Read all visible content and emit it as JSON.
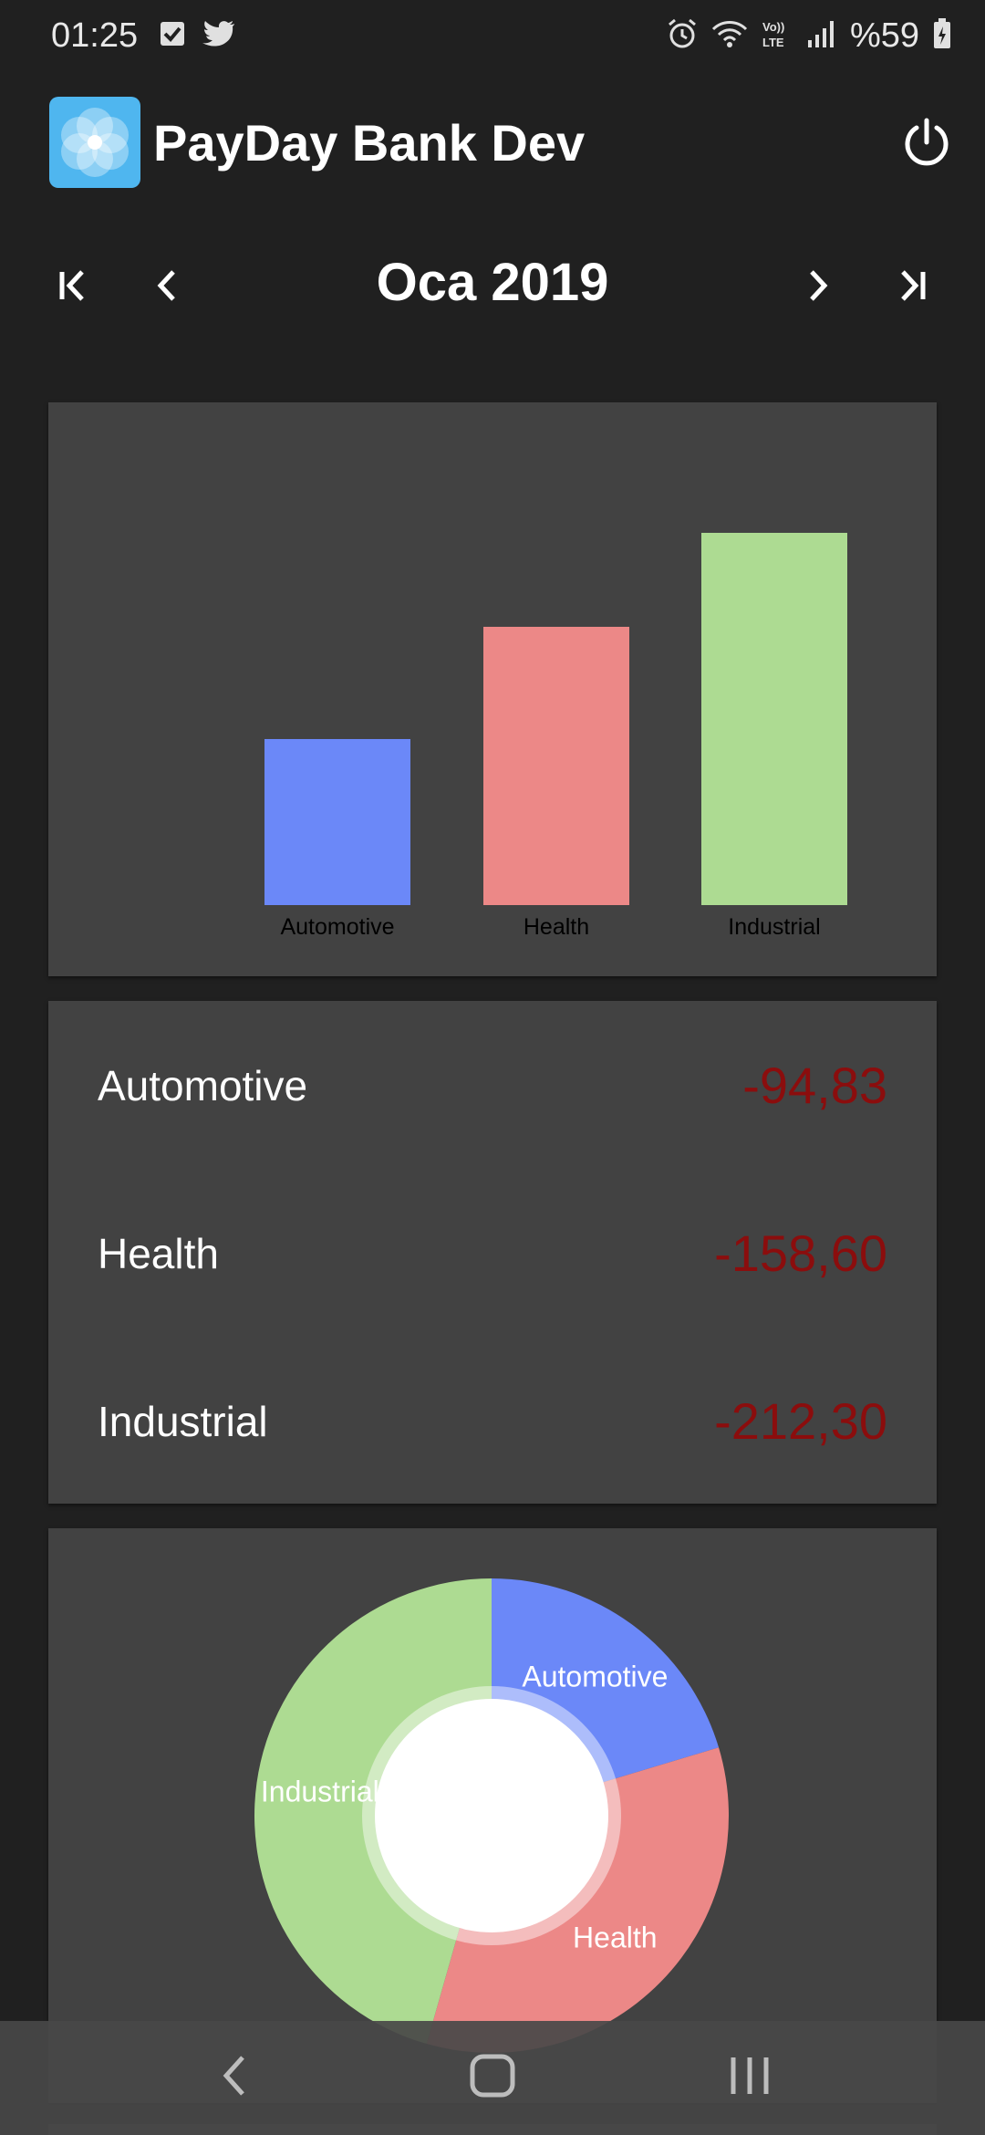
{
  "status_bar": {
    "time": "01:25",
    "battery": "%59",
    "icons": [
      "checkbox-notification-icon",
      "twitter-icon",
      "alarm-icon",
      "wifi-icon",
      "volte-icon",
      "signal-icon",
      "battery-icon"
    ]
  },
  "app_bar": {
    "title": "PayDay Bank Dev",
    "logo_icon": "flower-logo-icon",
    "power_icon": "power-icon"
  },
  "month_nav": {
    "label": "Oca 2019",
    "icons": [
      "first-page-icon",
      "chevron-left-icon",
      "chevron-right-icon",
      "last-page-icon"
    ]
  },
  "chart_data": [
    {
      "type": "bar",
      "categories": [
        "Automotive",
        "Health",
        "Industrial"
      ],
      "values": [
        94.83,
        158.6,
        212.3
      ],
      "colors": [
        "#6b88f8",
        "#ec8887",
        "#addb92"
      ],
      "title": "",
      "xlabel": "",
      "ylabel": "",
      "grid": false,
      "legend": "none"
    },
    {
      "type": "pie",
      "subtype": "donut",
      "categories": [
        "Automotive",
        "Health",
        "Industrial"
      ],
      "values": [
        94.83,
        158.6,
        212.3
      ],
      "colors": [
        "#6b88f8",
        "#ec8887",
        "#addb92"
      ],
      "labels_on_slices": true,
      "legend": "none"
    }
  ],
  "summary_list": {
    "items": [
      {
        "label": "Automotive",
        "value": "-94,83"
      },
      {
        "label": "Health",
        "value": "-158,60"
      },
      {
        "label": "Industrial",
        "value": "-212,30"
      }
    ],
    "value_color": "#8b0d0d"
  },
  "bottom_nav": {
    "icons": [
      "back-icon",
      "home-icon",
      "recents-icon"
    ]
  }
}
